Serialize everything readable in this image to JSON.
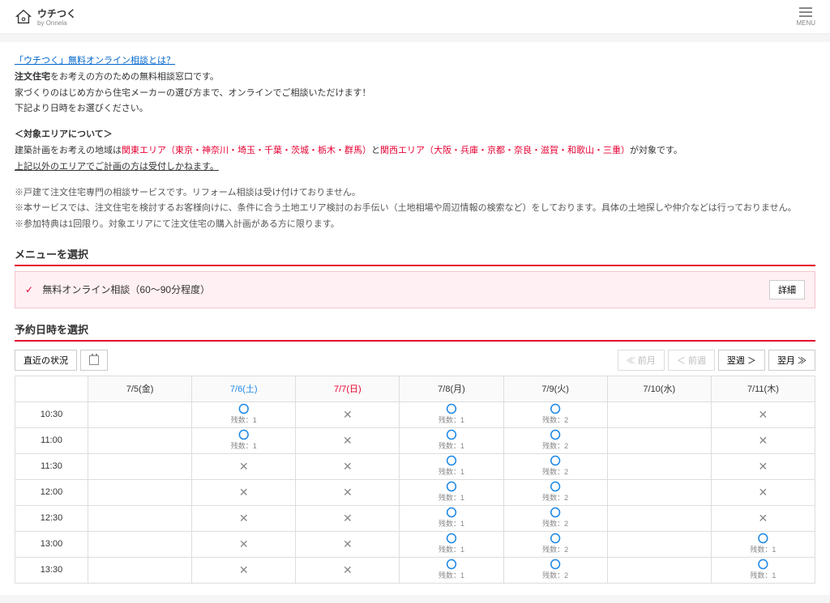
{
  "header": {
    "logo_main": "ウチつく",
    "logo_sub": "by Onnela",
    "menu_label": "MENU"
  },
  "intro": {
    "title_link": "「ウチつく」無料オンライン相談とは？",
    "line1_bold": "注文住宅",
    "line1_rest": "をお考えの方のための無料相談窓口です。",
    "line2": "家づくりのはじめ方から住宅メーカーの選び方まで、オンラインでご相談いただけます！",
    "line3": "下記より日時をお選びください。",
    "area_heading": "＜対象エリアについて＞",
    "area_pre": "建築計画をお考えの地域は",
    "area_kanto": "関東エリア（東京・神奈川・埼玉・千葉・茨城・栃木・群馬）",
    "area_mid": "と",
    "area_kansai": "関西エリア（大阪・兵庫・京都・奈良・滋賀・和歌山・三重）",
    "area_post": "が対象です。",
    "area_note": "上記以外のエリアでご計画の方は受付しかねます。",
    "note1": "※戸建て注文住宅専門の相談サービスです。リフォーム相談は受け付けておりません。",
    "note2": "※本サービスでは、注文住宅を検討するお客様向けに、条件に合う土地エリア検討のお手伝い（土地相場や周辺情報の検索など）をしております。具体の土地探しや仲介などは行っておりません。",
    "note3": "※参加特典は1回限り。対象エリアにて注文住宅の購入計画がある方に限ります。"
  },
  "menu_section": {
    "title": "メニューを選択",
    "item_label": "無料オンライン相談（60〜90分程度）",
    "detail_btn": "詳細"
  },
  "datetime_section": {
    "title": "予約日時を選択",
    "recent_btn": "直近の状況",
    "prev_month": "≪ 前月",
    "prev_week": "＜ 前週",
    "next_week": "翌週 ＞",
    "next_month": "翌月 ≫"
  },
  "calendar": {
    "time_header": "",
    "days": [
      {
        "label": "7/5(金)",
        "cls": ""
      },
      {
        "label": "7/6(土)",
        "cls": "sat"
      },
      {
        "label": "7/7(日)",
        "cls": "sun"
      },
      {
        "label": "7/8(月)",
        "cls": ""
      },
      {
        "label": "7/9(火)",
        "cls": ""
      },
      {
        "label": "7/10(水)",
        "cls": ""
      },
      {
        "label": "7/11(木)",
        "cls": ""
      }
    ],
    "rows": [
      {
        "time": "10:30",
        "cells": [
          {
            "t": "e"
          },
          {
            "t": "o",
            "r": 1
          },
          {
            "t": "x"
          },
          {
            "t": "o",
            "r": 1
          },
          {
            "t": "o",
            "r": 2
          },
          {
            "t": "e"
          },
          {
            "t": "x"
          }
        ]
      },
      {
        "time": "11:00",
        "cells": [
          {
            "t": "e"
          },
          {
            "t": "o",
            "r": 1
          },
          {
            "t": "x"
          },
          {
            "t": "o",
            "r": 1
          },
          {
            "t": "o",
            "r": 2
          },
          {
            "t": "e"
          },
          {
            "t": "x"
          }
        ]
      },
      {
        "time": "11:30",
        "cells": [
          {
            "t": "e"
          },
          {
            "t": "x"
          },
          {
            "t": "x"
          },
          {
            "t": "o",
            "r": 1
          },
          {
            "t": "o",
            "r": 2
          },
          {
            "t": "e"
          },
          {
            "t": "x"
          }
        ]
      },
      {
        "time": "12:00",
        "cells": [
          {
            "t": "e"
          },
          {
            "t": "x"
          },
          {
            "t": "x"
          },
          {
            "t": "o",
            "r": 1
          },
          {
            "t": "o",
            "r": 2
          },
          {
            "t": "e"
          },
          {
            "t": "x"
          }
        ]
      },
      {
        "time": "12:30",
        "cells": [
          {
            "t": "e"
          },
          {
            "t": "x"
          },
          {
            "t": "x"
          },
          {
            "t": "o",
            "r": 1
          },
          {
            "t": "o",
            "r": 2
          },
          {
            "t": "e"
          },
          {
            "t": "x"
          }
        ]
      },
      {
        "time": "13:00",
        "cells": [
          {
            "t": "e"
          },
          {
            "t": "x"
          },
          {
            "t": "x"
          },
          {
            "t": "o",
            "r": 1
          },
          {
            "t": "o",
            "r": 2
          },
          {
            "t": "e"
          },
          {
            "t": "o",
            "r": 1
          }
        ]
      },
      {
        "time": "13:30",
        "cells": [
          {
            "t": "e"
          },
          {
            "t": "x"
          },
          {
            "t": "x"
          },
          {
            "t": "o",
            "r": 1
          },
          {
            "t": "o",
            "r": 2
          },
          {
            "t": "e"
          },
          {
            "t": "o",
            "r": 1
          }
        ]
      }
    ],
    "remain_prefix": "残数："
  }
}
